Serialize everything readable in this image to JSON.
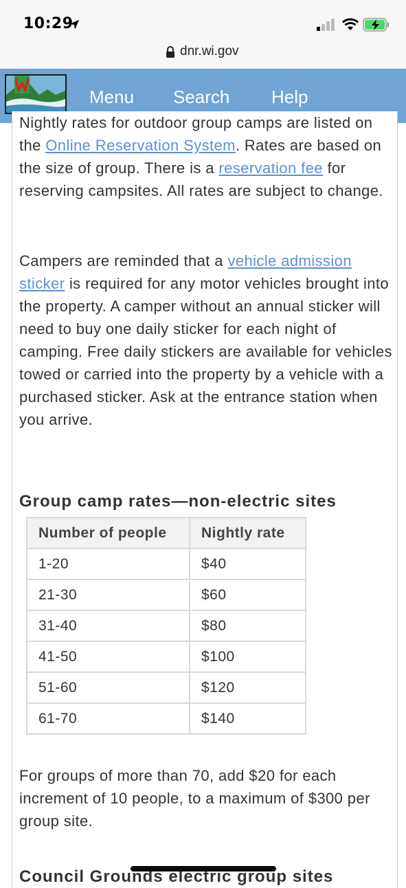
{
  "status_bar": {
    "time": "10:29"
  },
  "browser": {
    "url": "dnr.wi.gov"
  },
  "nav": {
    "items": [
      "Menu",
      "Search",
      "Help"
    ]
  },
  "content": {
    "para1": {
      "pre": "Nightly rates for outdoor group camps are listed on the ",
      "link1": "Online Reservation System",
      "mid": ". Rates are based on the size of group. There is a ",
      "link2": "reservation fee",
      "post": " for reserving campsites. All rates are subject to change."
    },
    "para2": {
      "pre": "Campers are reminded that a ",
      "link": "vehicle admission sticker",
      "post": " is required for any motor vehicles brought into the property. A camper without an annual sticker will need to buy one daily sticker for each night of camping. Free daily stickers are available for vehicles towed or carried into the property by a vehicle with a purchased sticker. Ask at the entrance station when you arrive."
    },
    "section_heading": "Group camp rates—non-electric sites",
    "table": {
      "headers": [
        "Number of people",
        "Nightly rate"
      ],
      "rows": [
        [
          "1-20",
          "$40"
        ],
        [
          "21-30",
          "$60"
        ],
        [
          "31-40",
          "$80"
        ],
        [
          "41-50",
          "$100"
        ],
        [
          "51-60",
          "$120"
        ],
        [
          "61-70",
          "$140"
        ]
      ]
    },
    "para3": "For groups of more than 70, add $20 for each increment of 10 people, to a maximum of $300 per group site.",
    "next_heading": "Council Grounds electric group sites"
  }
}
